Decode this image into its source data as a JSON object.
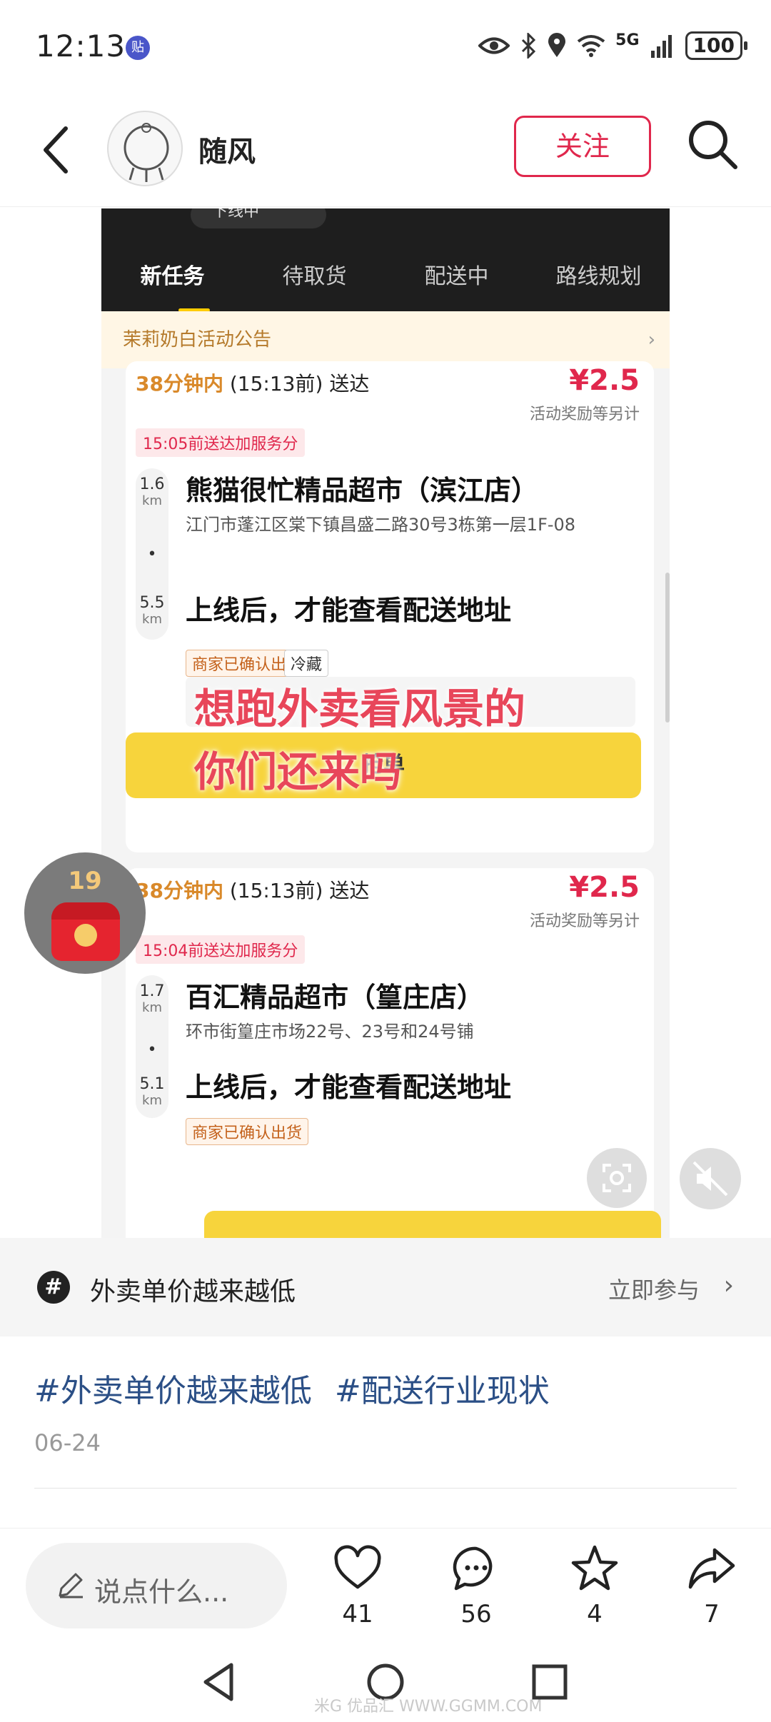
{
  "status_bar": {
    "time": "12:13",
    "badge": "贴",
    "network": "5G",
    "battery": "100"
  },
  "header": {
    "username": "随风",
    "follow_label": "关注"
  },
  "post_image": {
    "top_pill": "下线中",
    "tabs": [
      "新任务",
      "待取货",
      "配送中",
      "路线规划"
    ],
    "notice": "茉莉奶白活动公告",
    "orders": [
      {
        "eta_highlight": "38分钟内",
        "eta_rest": "(15:13前) 送达",
        "price": "¥2.5",
        "reward_note": "活动奖励等另计",
        "service_tag": "15:05前送达加服务分",
        "pickup_km": "1.6",
        "km_unit": "km",
        "store": "熊猫很忙精品超市（滨江店）",
        "address": "江门市蓬江区棠下镇昌盛二路30号3栋第一层1F-08",
        "deliver_km": "5.5",
        "deliver_text": "上线后，才能查看配送地址",
        "chip_confirmed": "商家已确认出货",
        "chip_cold": "冷藏",
        "grab_label": "抢单"
      },
      {
        "eta_highlight": "38分钟内",
        "eta_rest": "(15:13前) 送达",
        "price": "¥2.5",
        "reward_note": "活动奖励等另计",
        "service_tag": "15:04前送达加服务分",
        "pickup_km": "1.7",
        "km_unit": "km",
        "store": "百汇精品超市（篁庄店）",
        "address": "环市街篁庄市场22号、23号和24号铺",
        "deliver_km": "5.1",
        "deliver_text": "上线后，才能查看配送地址",
        "chip_confirmed": "商家已确认出货"
      }
    ],
    "overlay_line1": "想跑外卖看风景的",
    "overlay_line2": "你们还来吗"
  },
  "red_packet": {
    "count": "19"
  },
  "topic": {
    "icon": "#",
    "name": "外卖单价越来越低",
    "join_label": "立即参与"
  },
  "post": {
    "hashtags": [
      "#外卖单价越来越低",
      "#配送行业现状"
    ],
    "date": "06-24"
  },
  "actions": {
    "comment_placeholder": "说点什么...",
    "likes": "41",
    "comments": "56",
    "favorites": "4",
    "shares": "7"
  },
  "watermark": "米G 优品汇 WWW.GGMM.COM"
}
